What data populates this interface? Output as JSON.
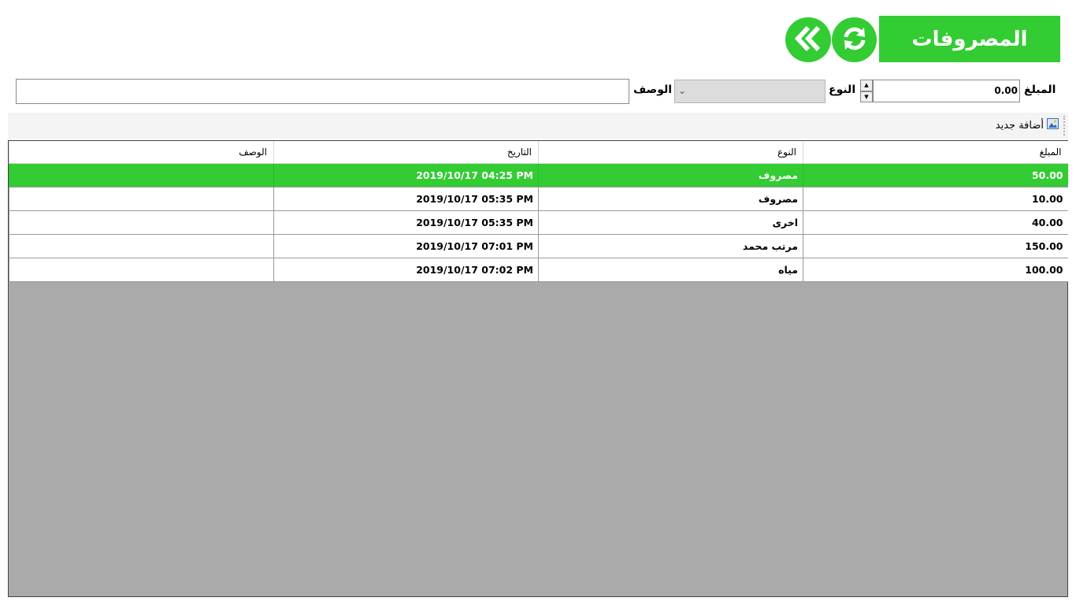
{
  "header": {
    "title": "المصروفات",
    "refresh_icon": "refresh-icon",
    "back_icon": "double-chevron-left-icon",
    "accent_color": "#33cc33"
  },
  "form": {
    "amount_label": "المبلغ",
    "amount_value": "0.00",
    "type_label": "النوع",
    "type_value": "",
    "description_label": "الوصف",
    "description_value": ""
  },
  "toolbar": {
    "add_new_label": "أضافة جديد",
    "add_new_icon": "image-icon"
  },
  "table": {
    "columns": [
      "المبلغ",
      "النوع",
      "التاريخ",
      "الوصف"
    ],
    "rows": [
      {
        "amount": "50.00",
        "type": "مصروف",
        "date": "2019/10/17 04:25 PM",
        "description": "",
        "selected": true
      },
      {
        "amount": "10.00",
        "type": "مصروف",
        "date": "2019/10/17 05:35 PM",
        "description": ""
      },
      {
        "amount": "40.00",
        "type": "اخرى",
        "date": "2019/10/17 05:35 PM",
        "description": ""
      },
      {
        "amount": "150.00",
        "type": "مرتب محمد",
        "date": "2019/10/17 07:01 PM",
        "description": ""
      },
      {
        "amount": "100.00",
        "type": "مياه",
        "date": "2019/10/17 07:02 PM",
        "description": ""
      }
    ]
  }
}
